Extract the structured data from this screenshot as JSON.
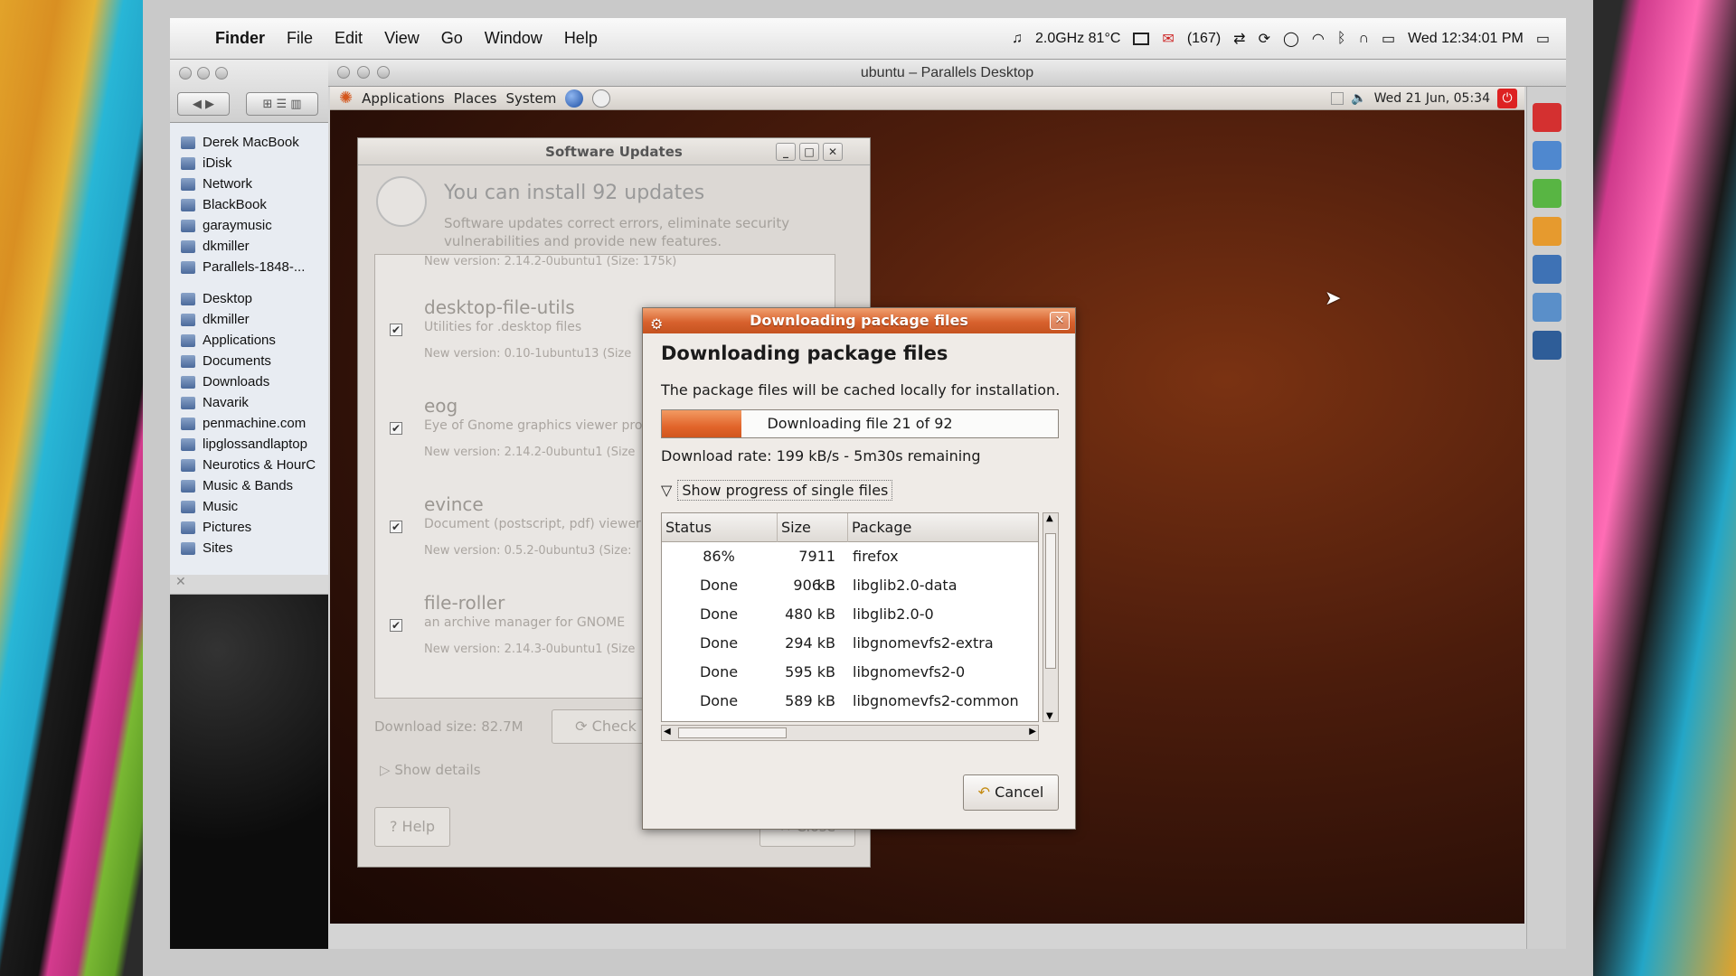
{
  "mac_menu": {
    "apple": "",
    "app": "Finder",
    "items": [
      "File",
      "Edit",
      "View",
      "Go",
      "Window",
      "Help"
    ],
    "status": {
      "music": "♫",
      "cpu": "2.0GHz 81°C",
      "mail_count": "(167)",
      "clock": "Wed 12:34:01 PM"
    }
  },
  "finder": {
    "sidebar_devices": [
      "Derek MacBook",
      "iDisk",
      "Network",
      "BlackBook",
      "garaymusic",
      "dkmiller",
      "Parallels-1848-..."
    ],
    "sidebar_places": [
      "Desktop",
      "dkmiller",
      "Applications",
      "Documents",
      "Downloads",
      "Navarik",
      "penmachine.com",
      "lipglossandlaptop",
      "Neurotics & HourC",
      "Music & Bands",
      "Music",
      "Pictures",
      "Sites"
    ]
  },
  "parallels": {
    "title": "ubuntu – Parallels Desktop"
  },
  "gnome_panel": {
    "applications": "Applications",
    "places": "Places",
    "system": "System",
    "clock": "Wed 21 Jun, 05:34"
  },
  "software_updates": {
    "title": "Software Updates",
    "heading": "You can install 92 updates",
    "subtitle": "Software updates correct errors, eliminate security vulnerabilities and provide new features.",
    "top_version": "New version: 2.14.2-0ubuntu1   (Size: 175k)",
    "updates": [
      {
        "name": "desktop-file-utils",
        "desc": "Utilities for .desktop files",
        "version": "New version: 0.10-1ubuntu13   (Size"
      },
      {
        "name": "eog",
        "desc": "Eye of Gnome graphics viewer progr",
        "version": "New version: 2.14.2-0ubuntu1   (Size"
      },
      {
        "name": "evince",
        "desc": "Document (postscript, pdf) viewer",
        "version": "New version: 0.5.2-0ubuntu3   (Size:"
      },
      {
        "name": "file-roller",
        "desc": "an archive manager for GNOME",
        "version": "New version: 2.14.3-0ubuntu1   (Size"
      }
    ],
    "download_size": "Download size: 82.7M",
    "check": "Check",
    "show_details": "Show details",
    "help": "Help",
    "close": "Close"
  },
  "download_dialog": {
    "title": "Downloading package files",
    "heading": "Downloading package files",
    "info": "The package files will be cached locally for installation.",
    "progress_label": "Downloading file 21 of 92",
    "progress_fraction": 0.2,
    "rate": "Download rate: 199 kB/s - 5m30s remaining",
    "expander": "Show progress of single files",
    "columns": [
      "Status",
      "Size",
      "Package"
    ],
    "rows": [
      {
        "status": "86%",
        "size": "7911 kB",
        "package": "firefox"
      },
      {
        "status": "Done",
        "size": "906  B",
        "package": "libglib2.0-data"
      },
      {
        "status": "Done",
        "size": "480 kB",
        "package": "libglib2.0-0"
      },
      {
        "status": "Done",
        "size": "294 kB",
        "package": "libgnomevfs2-extra"
      },
      {
        "status": "Done",
        "size": "595 kB",
        "package": "libgnomevfs2-0"
      },
      {
        "status": "Done",
        "size": "589 kB",
        "package": "libgnomevfs2-common"
      }
    ],
    "cancel": "Cancel"
  }
}
